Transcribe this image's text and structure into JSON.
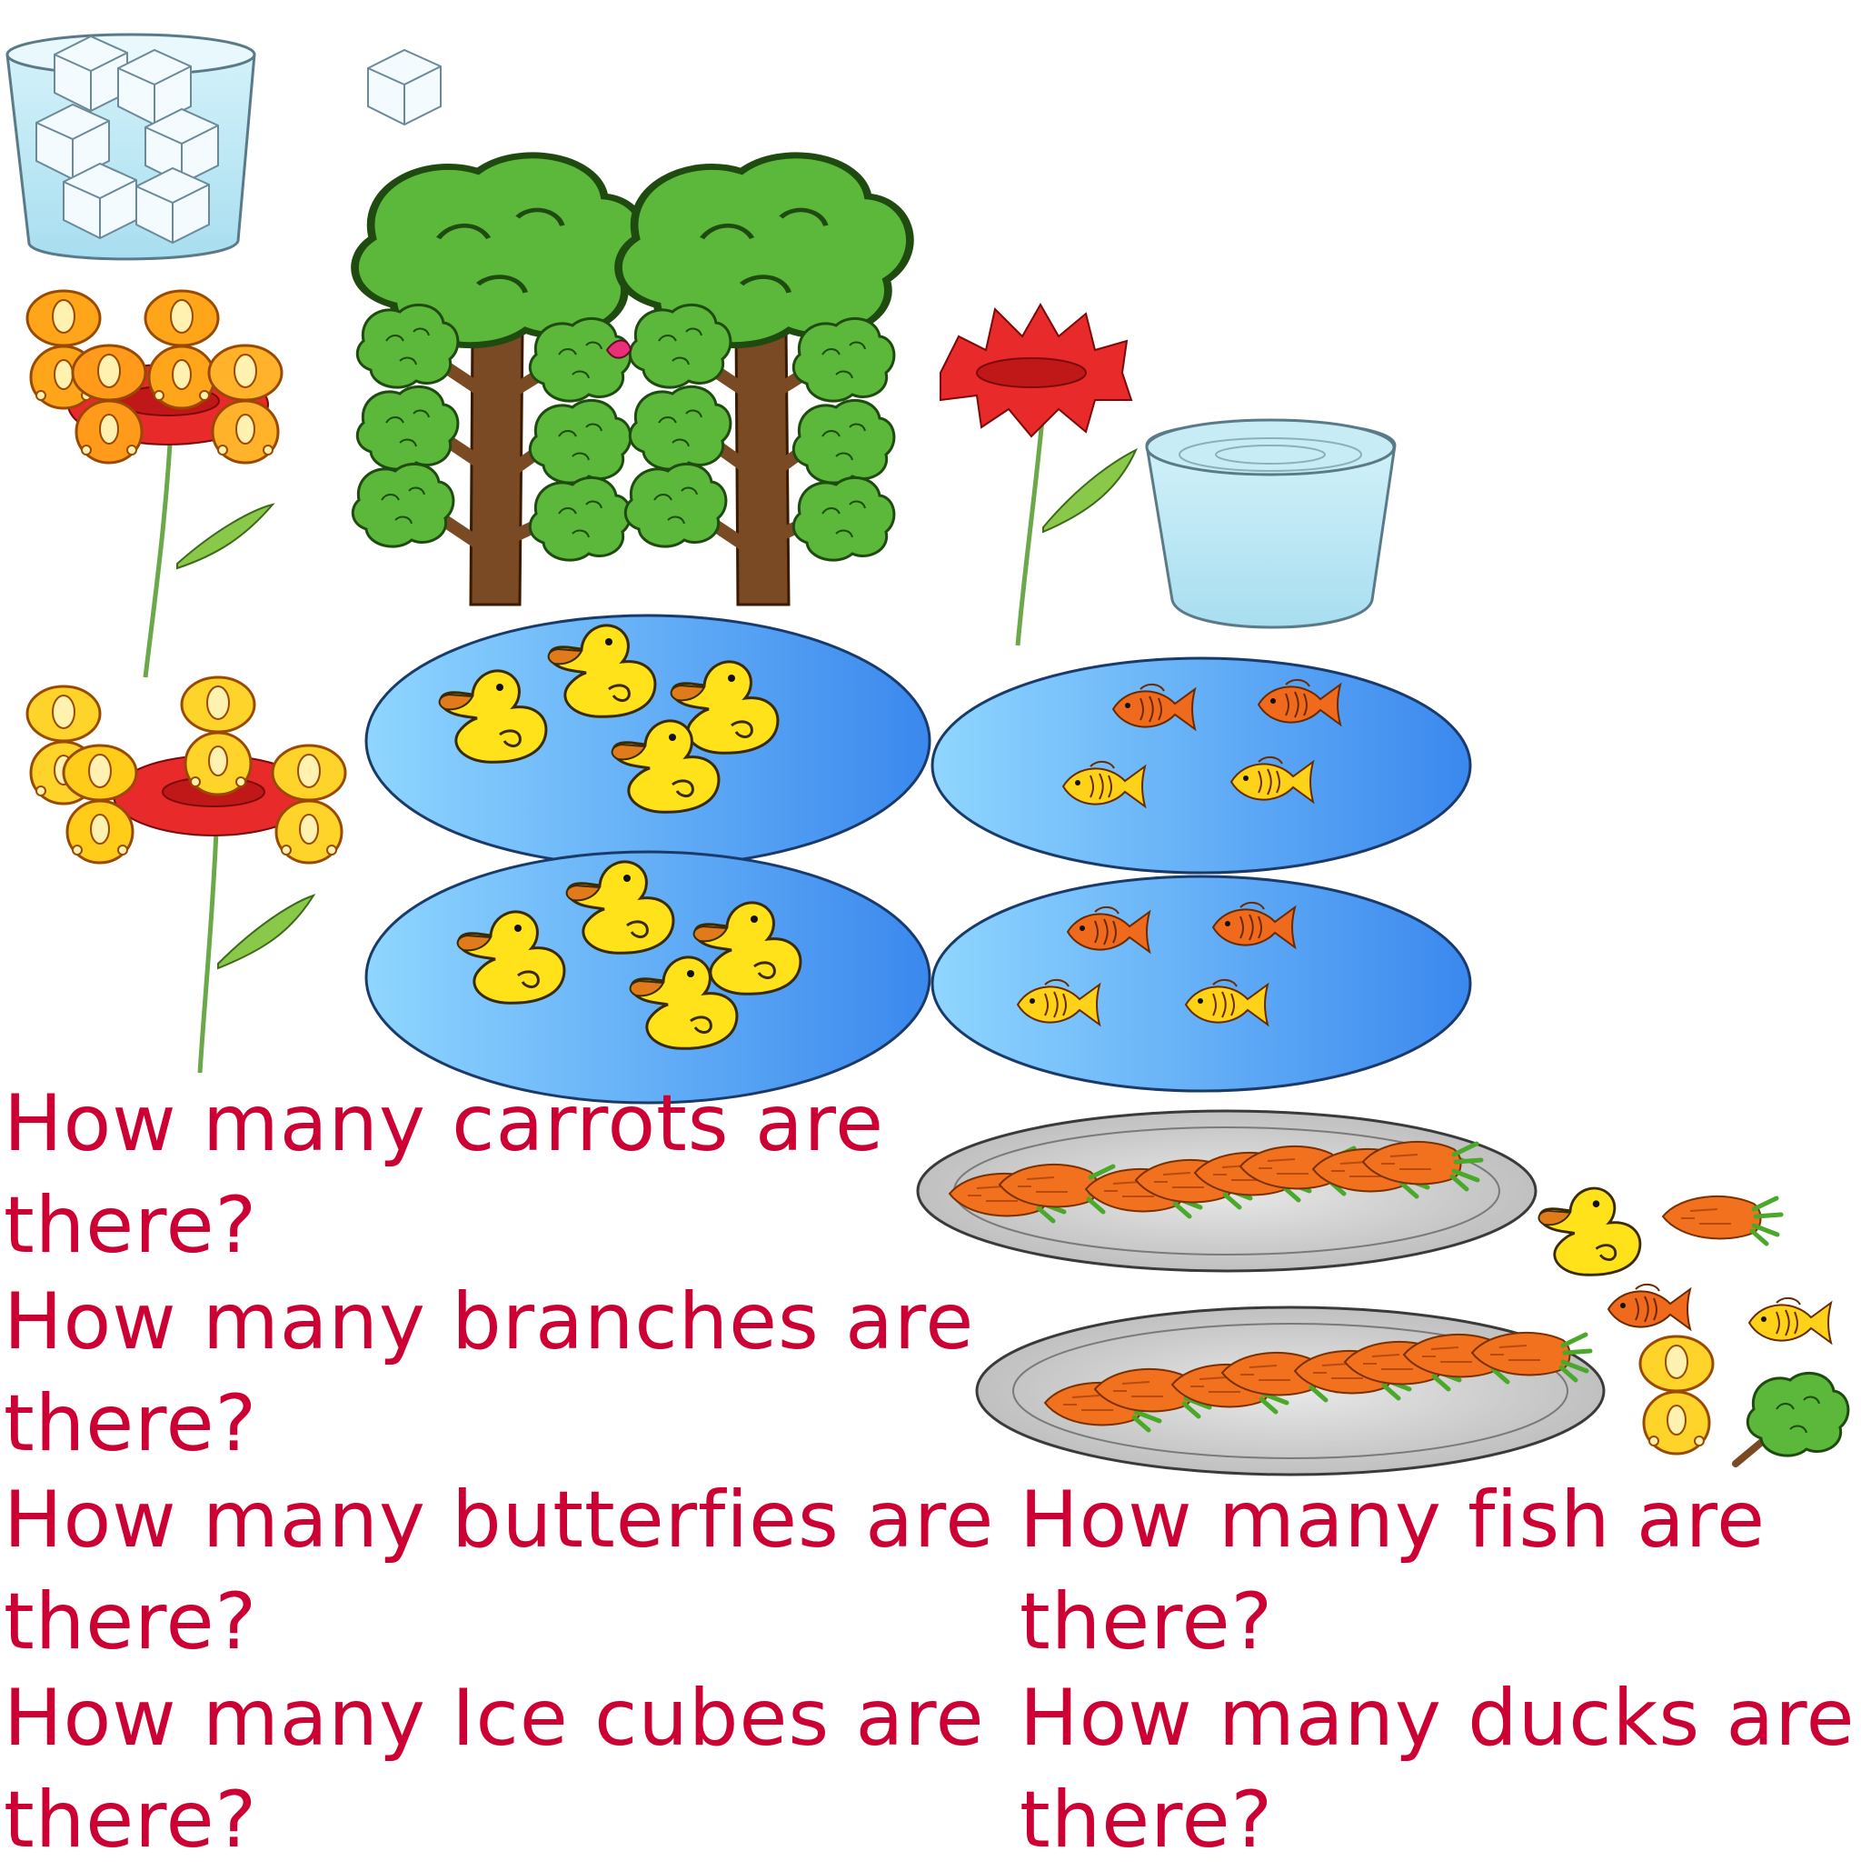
{
  "questions": {
    "carrots": {
      "line1": "How many carrots are",
      "line2": "there?"
    },
    "branches": {
      "line1": "How many branches are",
      "line2": "there?"
    },
    "butterflies": {
      "line1": "How many butterfies are",
      "line2": "there?"
    },
    "fish": {
      "line1": "How many fish are",
      "line2": "there?"
    },
    "ice_cubes": {
      "line1": "How many Ice cubes are",
      "line2": "there?"
    },
    "ducks": {
      "line1": "How many ducks are",
      "line2": "there?"
    }
  },
  "colors": {
    "question_text": "#cc0033",
    "pond_light": "#8fd0ff",
    "pond_dark": "#3a8ef0",
    "duck_yellow": "#ffe21a",
    "duck_beak": "#e07a1a",
    "fish_orange": "#f06a1e",
    "fish_yellow": "#ffd21a",
    "leaf_green": "#5cb83a",
    "trunk_brown": "#7a4a24",
    "carrot_orange": "#f2711e",
    "petal_red": "#e82a2a",
    "butterfly_orange": "#ffa51a",
    "butterfly_yellow": "#ffd42a",
    "glass_blue": "#bfeaf5"
  }
}
